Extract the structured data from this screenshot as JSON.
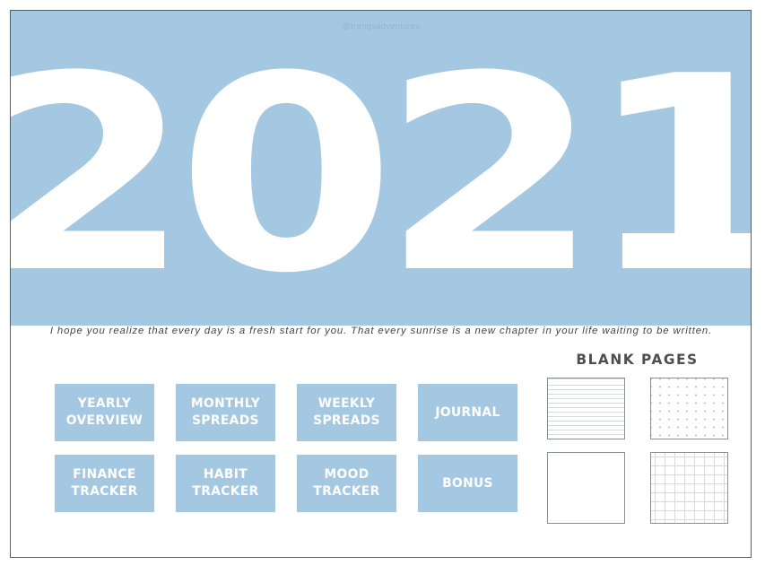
{
  "hero": {
    "handle": "@trangsadventures",
    "year": "2021",
    "background_color": "#a5c8e2",
    "year_color": "#ffffff"
  },
  "quote": {
    "text": "I hope you realize that every day is a fresh start for you. That every sunrise is a new chapter in your life waiting to be written."
  },
  "nav_buttons": [
    {
      "label": "YEARLY\nOVERVIEW",
      "name": "yearly-overview"
    },
    {
      "label": "MONTHLY\nSPREADS",
      "name": "monthly-spreads"
    },
    {
      "label": "WEEKLY\nSPREADS",
      "name": "weekly-spreads"
    },
    {
      "label": "JOURNAL",
      "name": "journal"
    },
    {
      "label": "FINANCE\nTRACKER",
      "name": "finance-tracker"
    },
    {
      "label": "HABIT\nTRACKER",
      "name": "habit-tracker"
    },
    {
      "label": "MOOD\nTRACKER",
      "name": "mood-tracker"
    },
    {
      "label": "BONUS",
      "name": "bonus"
    }
  ],
  "blank_pages": {
    "title": "BLANK PAGES",
    "title_color": "#4a4f54",
    "thumbnails": [
      {
        "style": "lined",
        "name": "lined-paper"
      },
      {
        "style": "dotted",
        "name": "dotted-paper"
      },
      {
        "style": "plain",
        "name": "plain-paper"
      },
      {
        "style": "grid",
        "name": "grid-paper"
      }
    ]
  },
  "theme": {
    "accent_blue": "#a5c8e2",
    "frame_color": "#55606b",
    "page_background": "#ffffff",
    "text_dark": "#3d4449"
  }
}
